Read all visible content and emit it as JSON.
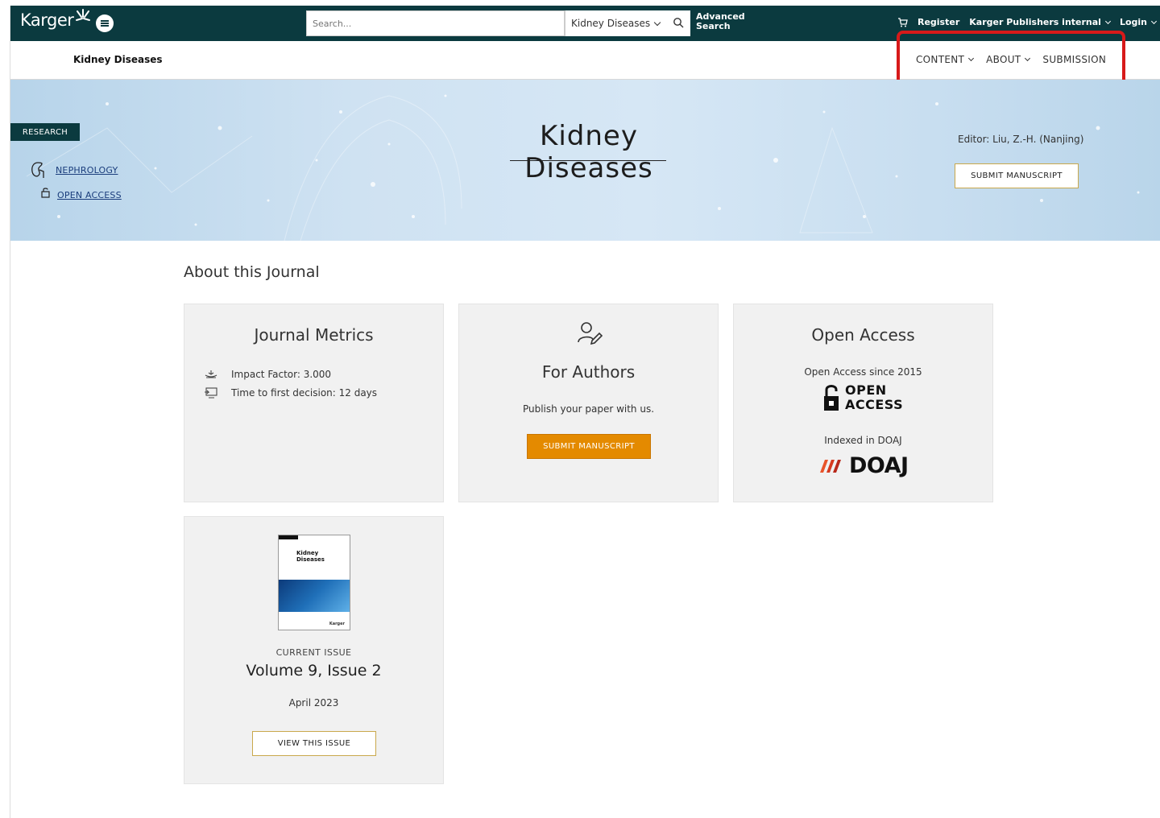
{
  "topbar": {
    "logo_text": "Karger",
    "search_placeholder": "Search...",
    "search_scope": "Kidney Diseases",
    "advanced_search_line1": "Advanced",
    "advanced_search_line2": "Search",
    "register": "Register",
    "org": "Karger Publishers internal",
    "login": "Login"
  },
  "journal_nav": {
    "journal_name": "Kidney Diseases",
    "links": [
      "CONTENT",
      "ABOUT",
      "SUBMISSION"
    ]
  },
  "hero": {
    "tag": "RESEARCH",
    "subject_link": "NEPHROLOGY",
    "access_link": "OPEN ACCESS",
    "title": "Kidney Diseases",
    "editor": "Editor: Liu, Z.-H. (Nanjing)",
    "submit_button": "SUBMIT MANUSCRIPT"
  },
  "about": {
    "section_title": "About this Journal",
    "metrics": {
      "title": "Journal Metrics",
      "impact_factor": "Impact Factor: 3.000",
      "time_to_decision": "Time to first decision: 12 days"
    },
    "authors": {
      "title": "For Authors",
      "text": "Publish your paper with us.",
      "button": "SUBMIT MANUSCRIPT"
    },
    "open_access": {
      "title": "Open Access",
      "since": "Open Access since 2015",
      "logo_line1": "OPEN",
      "logo_line2": "ACCESS",
      "indexed": "Indexed in DOAJ",
      "doaj": "DOAJ"
    },
    "current_issue": {
      "cover_title_line1": "Kidney",
      "cover_title_line2": "Diseases",
      "cover_brand": "Karger",
      "label": "CURRENT ISSUE",
      "volume": "Volume 9, Issue 2",
      "date": "April 2023",
      "button": "VIEW THIS ISSUE"
    }
  },
  "colors": {
    "topbar": "#0b3a3f",
    "accent_orange": "#e48a00",
    "highlight_red": "#d71a1a",
    "gold_border": "#c9a84c"
  }
}
